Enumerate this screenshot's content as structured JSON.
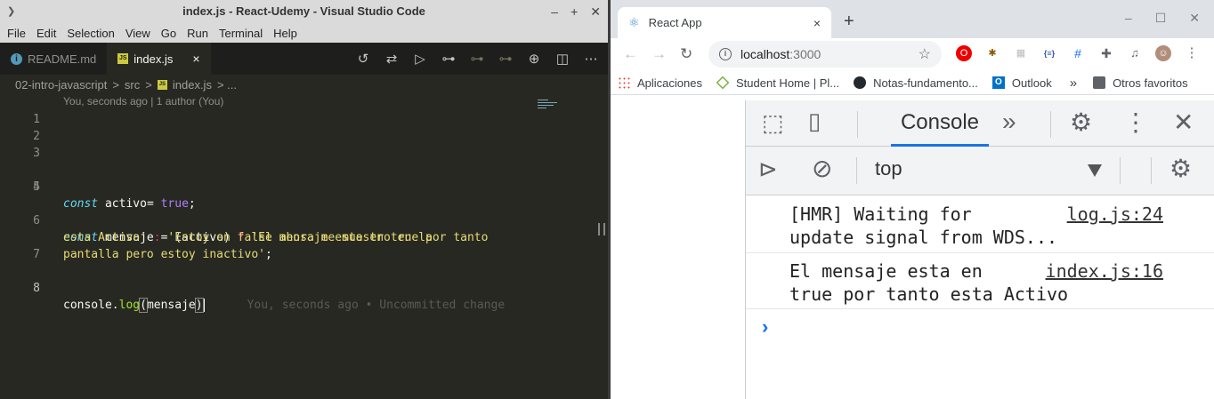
{
  "vscode": {
    "title": "index.js - React-Udemy - Visual Studio Code",
    "menu": [
      "File",
      "Edit",
      "Selection",
      "View",
      "Go",
      "Run",
      "Terminal",
      "Help"
    ],
    "tabs": [
      {
        "label": "README.md",
        "icon": "info-icon"
      },
      {
        "label": "index.js",
        "icon": "js-file-icon",
        "close": "×"
      }
    ],
    "breadcrumb": [
      "02-intro-javascript",
      ">",
      "src",
      ">",
      "index.js",
      "> ..."
    ],
    "codelens": "You, seconds ago | 1 author (You)",
    "line_numbers": [
      "1",
      "2",
      "3",
      "4",
      "5",
      "6",
      "7",
      "8"
    ],
    "code": {
      "l4_kw": "const",
      "l4_var": " activo",
      "l4_eq": "= ",
      "l4_val": "true",
      "l4_end": ";",
      "l6_kw": "const",
      "l6_var": " mensaje = (activo) ",
      "l6_q": "?",
      "l6_str1": " 'El mensaje esta en true por tanto",
      "l6b_str1": "esta Activo'",
      "l6b_colon": " : ",
      "l6b_str2": "'Estoy en false ahora me muestro en la",
      "l6c_str2": "pantalla pero estoy inactivo'",
      "l6c_end": ";",
      "l8_obj": "console.",
      "l8_fn": "log",
      "l8_paren": "(",
      "l8_arg": "mensaje",
      "l8_close": ")",
      "l8_blame": "You, seconds ago • Uncommitted change"
    }
  },
  "chrome": {
    "tab_title": "React App",
    "tab_close": "×",
    "new_tab": "+",
    "url_host": "localhost",
    "url_port": ":3000",
    "bookmarks": [
      "Aplicaciones",
      "Student Home | Pl...",
      "Notas-fundamento...",
      "Outlook",
      "»",
      "Otros favoritos"
    ],
    "colors": {
      "accent": "#1a73e8",
      "react": "#4a8ec2"
    }
  },
  "devtools": {
    "panel": "Console",
    "more": "»",
    "context": "top",
    "messages": [
      {
        "line1": "[HMR] Waiting for",
        "line2": "update signal from WDS...",
        "source": "log.js:24"
      },
      {
        "line1": "El mensaje esta en",
        "line2": "true por tanto esta Activo",
        "source": "index.js:16"
      }
    ],
    "prompt": "›"
  }
}
